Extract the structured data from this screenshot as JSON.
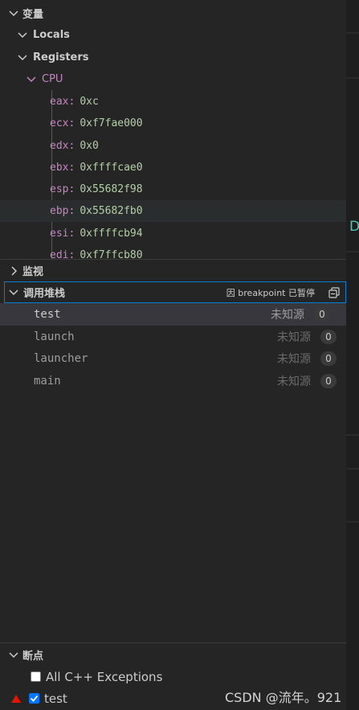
{
  "variables": {
    "header": "变量",
    "locals": "Locals",
    "registers": "Registers",
    "cpu": "CPU",
    "regs": [
      {
        "key": "eax:",
        "val": "0xc"
      },
      {
        "key": "ecx:",
        "val": "0xf7fae000"
      },
      {
        "key": "edx:",
        "val": "0x0"
      },
      {
        "key": "ebx:",
        "val": "0xffffcae0"
      },
      {
        "key": "esp:",
        "val": "0x55682f98"
      },
      {
        "key": "ebp:",
        "val": "0x55682fb0"
      },
      {
        "key": "esi:",
        "val": "0xffffcb94"
      },
      {
        "key": "edi:",
        "val": "0xf7ffcb80"
      }
    ]
  },
  "watch": {
    "header": "监视"
  },
  "callstack": {
    "header": "调用堆栈",
    "pause_reason": "因 breakpoint 已暂停",
    "frames": [
      {
        "name": "test",
        "source": "未知源",
        "line": "0"
      },
      {
        "name": "launch",
        "source": "未知源",
        "line": "0"
      },
      {
        "name": "launcher",
        "source": "未知源",
        "line": "0"
      },
      {
        "name": "main",
        "source": "未知源",
        "line": "0"
      }
    ]
  },
  "breakpoints": {
    "header": "断点",
    "items": [
      {
        "label": "All C++ Exceptions",
        "checked": false
      },
      {
        "label": "test",
        "checked": true
      }
    ]
  },
  "watermark": "CSDN @流年。921",
  "editor_fragment": "D",
  "colors": {
    "accent": "#007fd4",
    "reg_key": "#c586c0",
    "reg_val": "#b5cea8",
    "breakpoint_red": "#e51400"
  }
}
